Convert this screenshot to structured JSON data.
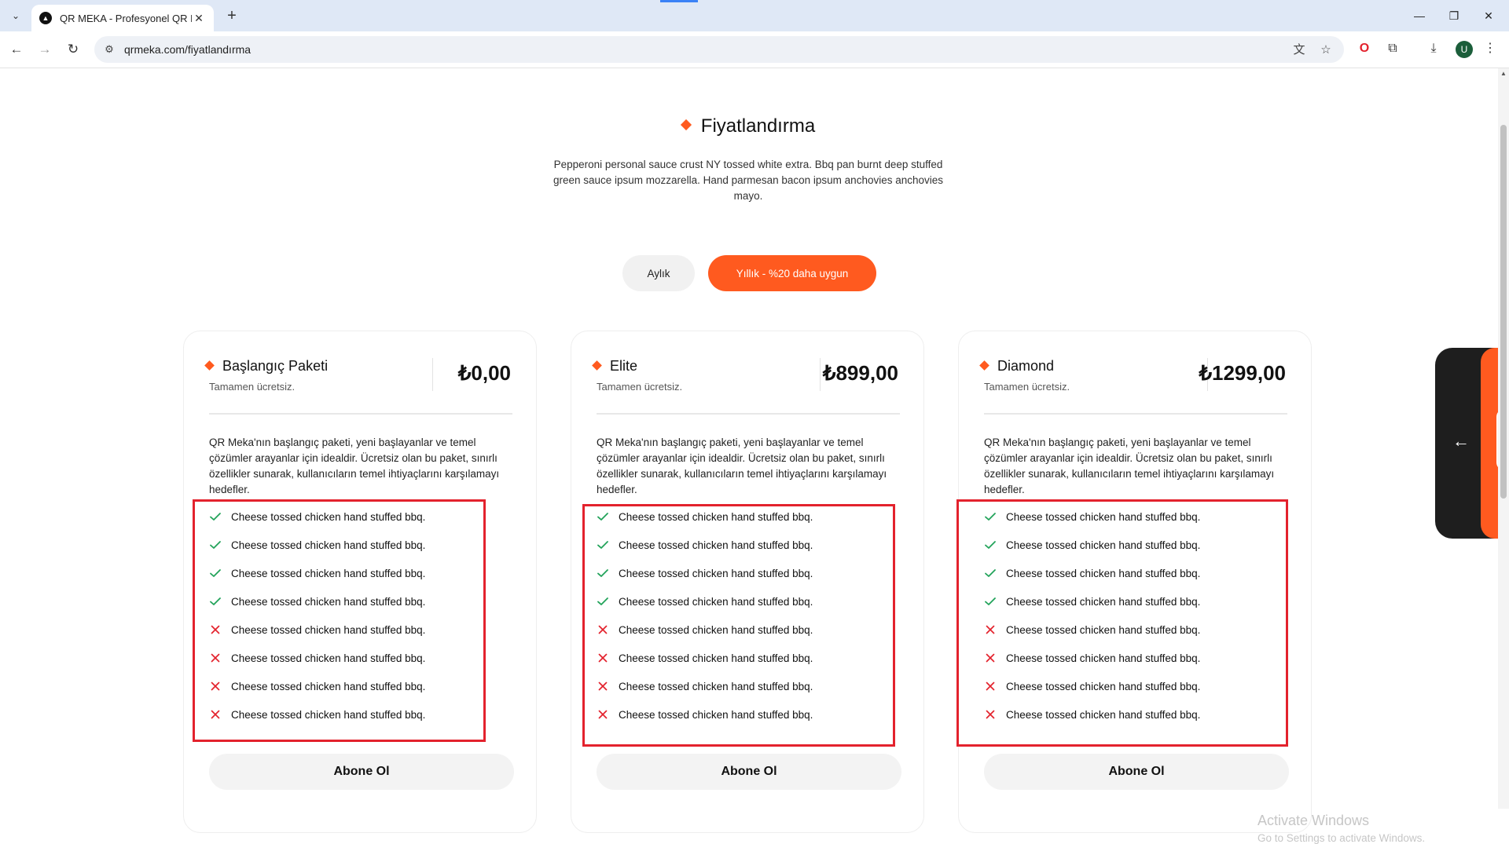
{
  "browser": {
    "tab_title": "QR MEKA - Profesyonel QR Menü",
    "url": "qrmeka.com/fiyatlandırma",
    "avatar_letter": "U",
    "accent_color": "#dfe8f6"
  },
  "page": {
    "heading": "Fiyatlandırma",
    "intro": "Pepperoni personal sauce crust NY tossed white extra. Bbq pan burnt deep stuffed green sauce ipsum mozzarella. Hand parmesan bacon ipsum anchovies anchovies mayo.",
    "billing": {
      "monthly_label": "Aylık",
      "yearly_label": "Yıllık - %20 daha uygun",
      "selected": "yearly"
    },
    "accent_color": "#ff5a1f",
    "plans": [
      {
        "name": "Başlangıç Paketi",
        "subtitle": "Tamamen ücretsiz.",
        "price": "₺0,00",
        "description": "QR Meka'nın başlangıç paketi, yeni başlayanlar ve temel çözümler arayanlar için idealdir. Ücretsiz olan bu paket, sınırlı özellikler sunarak, kullanıcıların temel ihtiyaçlarını karşılamayı hedefler.",
        "features": [
          {
            "text": "Cheese tossed chicken hand stuffed bbq.",
            "included": true
          },
          {
            "text": "Cheese tossed chicken hand stuffed bbq.",
            "included": true
          },
          {
            "text": "Cheese tossed chicken hand stuffed bbq.",
            "included": true
          },
          {
            "text": "Cheese tossed chicken hand stuffed bbq.",
            "included": true
          },
          {
            "text": "Cheese tossed chicken hand stuffed bbq.",
            "included": false
          },
          {
            "text": "Cheese tossed chicken hand stuffed bbq.",
            "included": false
          },
          {
            "text": "Cheese tossed chicken hand stuffed bbq.",
            "included": false
          },
          {
            "text": "Cheese tossed chicken hand stuffed bbq.",
            "included": false
          }
        ],
        "button": "Abone Ol"
      },
      {
        "name": "Elite",
        "subtitle": "Tamamen ücretsiz.",
        "price": "₺899,00",
        "description": "QR Meka'nın başlangıç paketi, yeni başlayanlar ve temel çözümler arayanlar için idealdir. Ücretsiz olan bu paket, sınırlı özellikler sunarak, kullanıcıların temel ihtiyaçlarını karşılamayı hedefler.",
        "features": [
          {
            "text": "Cheese tossed chicken hand stuffed bbq.",
            "included": true
          },
          {
            "text": "Cheese tossed chicken hand stuffed bbq.",
            "included": true
          },
          {
            "text": "Cheese tossed chicken hand stuffed bbq.",
            "included": true
          },
          {
            "text": "Cheese tossed chicken hand stuffed bbq.",
            "included": true
          },
          {
            "text": "Cheese tossed chicken hand stuffed bbq.",
            "included": false
          },
          {
            "text": "Cheese tossed chicken hand stuffed bbq.",
            "included": false
          },
          {
            "text": "Cheese tossed chicken hand stuffed bbq.",
            "included": false
          },
          {
            "text": "Cheese tossed chicken hand stuffed bbq.",
            "included": false
          }
        ],
        "button": "Abone Ol"
      },
      {
        "name": "Diamond",
        "subtitle": "Tamamen ücretsiz.",
        "price": "₺1299,00",
        "description": "QR Meka'nın başlangıç paketi, yeni başlayanlar ve temel çözümler arayanlar için idealdir. Ücretsiz olan bu paket, sınırlı özellikler sunarak, kullanıcıların temel ihtiyaçlarını karşılamayı hedefler.",
        "features": [
          {
            "text": "Cheese tossed chicken hand stuffed bbq.",
            "included": true
          },
          {
            "text": "Cheese tossed chicken hand stuffed bbq.",
            "included": true
          },
          {
            "text": "Cheese tossed chicken hand stuffed bbq.",
            "included": true
          },
          {
            "text": "Cheese tossed chicken hand stuffed bbq.",
            "included": true
          },
          {
            "text": "Cheese tossed chicken hand stuffed bbq.",
            "included": false
          },
          {
            "text": "Cheese tossed chicken hand stuffed bbq.",
            "included": false
          },
          {
            "text": "Cheese tossed chicken hand stuffed bbq.",
            "included": false
          },
          {
            "text": "Cheese tossed chicken hand stuffed bbq.",
            "included": false
          }
        ],
        "button": "Abone Ol"
      }
    ]
  },
  "icons": {
    "included": "check-icon",
    "excluded": "x-icon",
    "included_color": "#22a35a",
    "excluded_color": "#e3222d"
  },
  "windows_notice": {
    "title": "Activate Windows",
    "subtitle": "Go to Settings to activate Windows."
  }
}
